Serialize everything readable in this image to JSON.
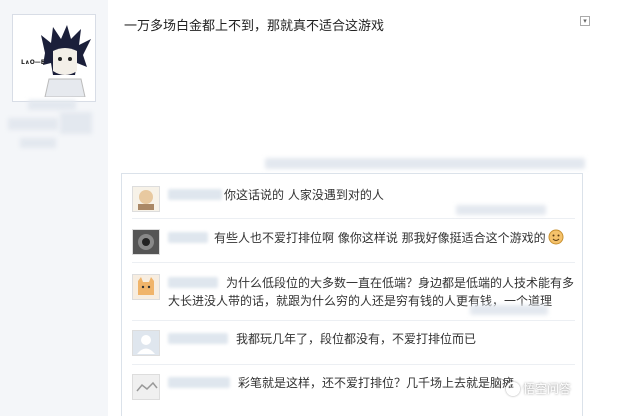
{
  "post": {
    "avatar_logo_text": "L∧O—E",
    "text": "一万多场白金都上不到，那就真不适合这游戏"
  },
  "replies": [
    {
      "text": "你这话说的 人家没遇到对的人"
    },
    {
      "text": "有些人也不爱打排位啊 像你这样说 那我好像挺适合这个游戏的"
    },
    {
      "text_line1": "为什么低段位的大多数一直在低端？身边都是低端的人技术能有多",
      "text_line2": "大长进没人带的话，就跟为什么穷的人还是穷有钱的人更有钱，一个道理"
    },
    {
      "text": "我都玩几年了，段位都没有，不爱打排位而已"
    },
    {
      "text": "彩笔就是这样，还不爱打排位？几千场上去就是脑瘫"
    }
  ],
  "watermark": {
    "text": "悟空问答"
  },
  "colors": {
    "border": "#dbe2ea",
    "sidebar": "#f4f6f9",
    "accent": "#1e8fd6"
  }
}
